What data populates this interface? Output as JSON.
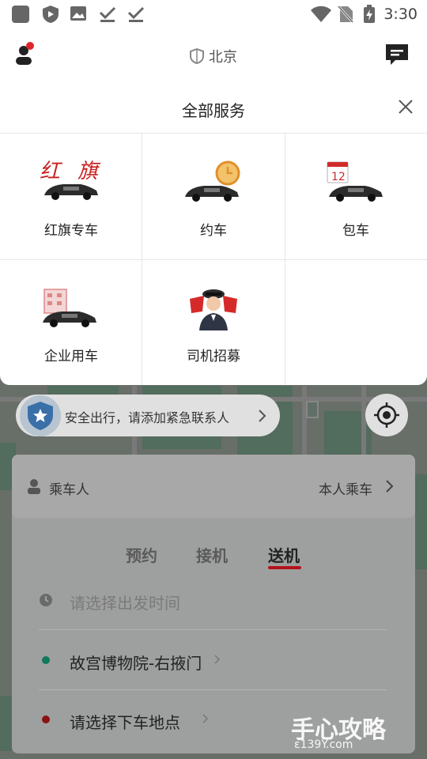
{
  "status_bar": {
    "time": "3:30"
  },
  "header": {
    "city": "北京"
  },
  "sheet": {
    "title": "全部服务",
    "services": [
      {
        "label": "红旗专车",
        "icon": "hongqi-car-icon"
      },
      {
        "label": "约车",
        "icon": "reserve-car-icon"
      },
      {
        "label": "包车",
        "icon": "charter-car-icon"
      },
      {
        "label": "企业用车",
        "icon": "enterprise-car-icon"
      },
      {
        "label": "司机招募",
        "icon": "driver-recruit-icon"
      }
    ]
  },
  "safety": {
    "text": "安全出行，请添加紧急联系人"
  },
  "card": {
    "passenger_label": "乘车人",
    "passenger_value": "本人乘车",
    "tabs": [
      "预约",
      "接机",
      "送机"
    ],
    "active_tab": "送机",
    "time_placeholder": "请选择出发时间",
    "pickup": "故宫博物院-右掖门",
    "dropoff_placeholder": "请选择下车地点"
  },
  "watermark": {
    "text": "手心攻略",
    "url": "ɛ139Y.com"
  },
  "colors": {
    "accent": "#b5121b",
    "pickup_dot": "#0e7a59",
    "dropoff_dot": "#8a1212"
  }
}
